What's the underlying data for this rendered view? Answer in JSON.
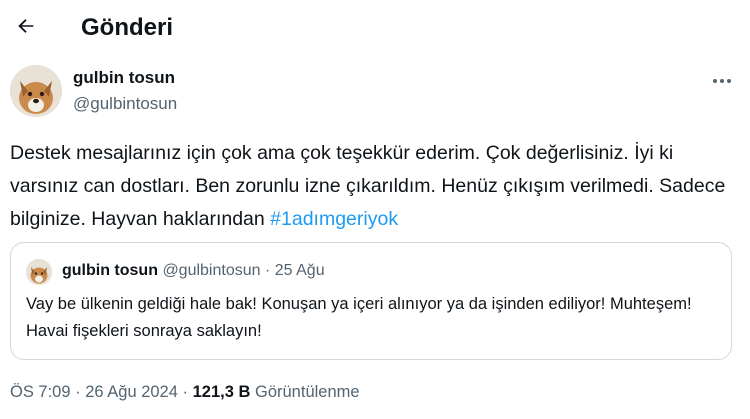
{
  "header": {
    "title": "Gönderi",
    "back_icon": "arrow-left-icon"
  },
  "post": {
    "author_name": "gulbin tosun",
    "author_handle": "@gulbintosun",
    "text_plain": "Destek mesajlarınız için çok ama çok teşekkür ederim. Çok değerlisiniz. İyi ki varsınız can dostları. Ben zorunlu izne çıkarıldım. Henüz çıkışım verilmedi. Sadece bilginize. Hayvan haklarından",
    "hashtag": "#1adımgeriyok",
    "more_icon": "more-horizontal-icon"
  },
  "quote": {
    "author_name": "gulbin tosun",
    "author_handle": "@gulbintosun",
    "separator": "·",
    "date": "25 Ağu",
    "text": "Vay be ülkenin geldiği hale bak! Konuşan ya içeri alınıyor ya da işinden ediliyor! Muhteşem! Havai fişekleri sonraya saklayın!"
  },
  "meta": {
    "time": "ÖS 7:09",
    "separator": "·",
    "date": "26 Ağu 2024",
    "views_count": "121,3 B",
    "views_label": "Görüntülenme"
  },
  "colors": {
    "text": "#0f1419",
    "secondary": "#536471",
    "link": "#1d9bf0",
    "border": "#cfd9de"
  }
}
